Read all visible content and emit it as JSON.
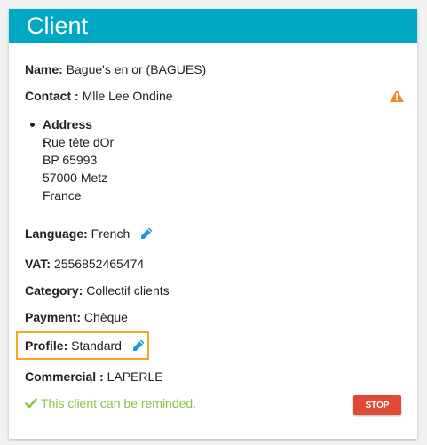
{
  "card": {
    "title": "Client"
  },
  "fields": {
    "name": {
      "label": "Name:",
      "value": "Bague's en or (BAGUES)"
    },
    "contact": {
      "label": "Contact :",
      "value": "Mlle Lee Ondine"
    },
    "address": {
      "label": "Address :",
      "lines": [
        "Rue tête dOr",
        "BP 65993",
        "57000 Metz",
        "France"
      ]
    },
    "language": {
      "label": "Language:",
      "value": "French"
    },
    "vat": {
      "label": "VAT:",
      "value": "2556852465474"
    },
    "category": {
      "label": "Category:",
      "value": "Collectif clients"
    },
    "payment": {
      "label": "Payment:",
      "value": "Chèque"
    },
    "profile": {
      "label": "Profile:",
      "value": "Standard"
    },
    "commercial": {
      "label": "Commercial :",
      "value": "LAPERLE"
    }
  },
  "status": {
    "remind_text": "This client can be reminded.",
    "stop_label": "STOP"
  },
  "icons": {
    "warning": "warning-icon",
    "edit": "pencil-icon",
    "check": "check-icon"
  },
  "colors": {
    "header": "#00a8c6",
    "edit_icon": "#1a9ad6",
    "warning": "#f08a24",
    "highlight_border": "#f5a623",
    "success": "#8bc34a",
    "stop_button": "#e04a35"
  }
}
